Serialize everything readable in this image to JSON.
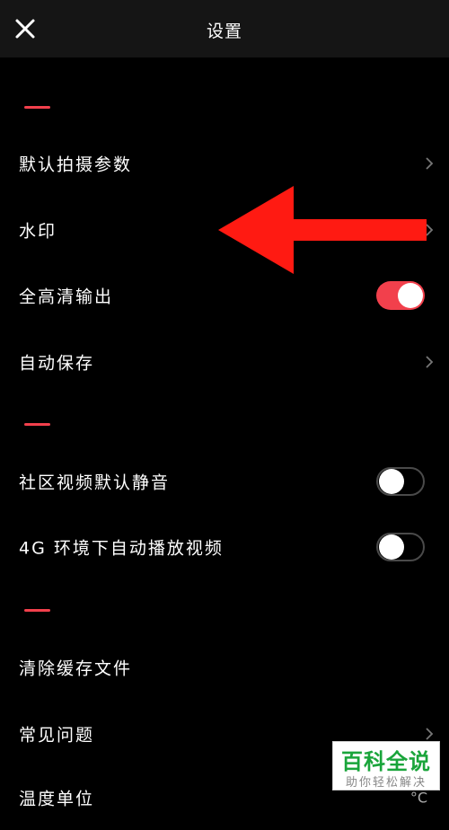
{
  "header": {
    "title": "设置",
    "close_icon": "close-icon"
  },
  "colors": {
    "accent": "#f2404c",
    "background": "#000000",
    "header_bg": "#151515"
  },
  "sections": [
    {
      "rows": [
        {
          "label": "默认拍摄参数",
          "control": "chevron"
        },
        {
          "label": "水印",
          "control": "chevron"
        },
        {
          "label": "全高清输出",
          "control": "toggle",
          "on": true
        },
        {
          "label": "自动保存",
          "control": "chevron"
        }
      ]
    },
    {
      "rows": [
        {
          "label": "社区视频默认静音",
          "control": "toggle",
          "on": false
        },
        {
          "label": "4G 环境下自动播放视频",
          "control": "toggle",
          "on": false
        }
      ]
    },
    {
      "rows": [
        {
          "label": "清除缓存文件",
          "control": "none"
        },
        {
          "label": "常见问题",
          "control": "chevron"
        },
        {
          "label": "温度单位",
          "control": "value",
          "value": "°C"
        }
      ]
    }
  ],
  "annotation": {
    "type": "red-arrow",
    "points_to": "水印"
  },
  "watermark": {
    "title": "百科全说",
    "subtitle": "助你轻松解决"
  }
}
